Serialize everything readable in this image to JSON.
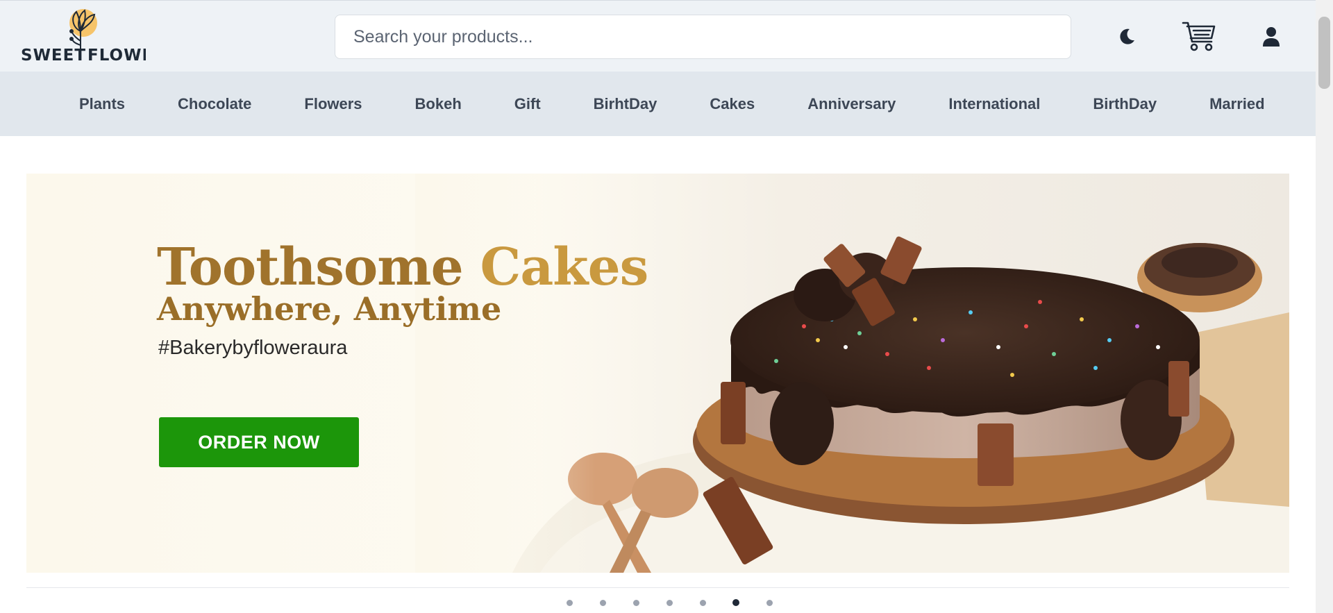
{
  "header": {
    "logo": {
      "line1": "SWEET",
      "line2": "FLOWER"
    },
    "search": {
      "placeholder": "Search your products..."
    },
    "icons": [
      "moon-icon",
      "cart-icon",
      "user-icon"
    ]
  },
  "categories": [
    "Plants",
    "Chocolate",
    "Flowers",
    "Bokeh",
    "Gift",
    "BirhtDay",
    "Cakes",
    "Anniversary",
    "International",
    "BirthDay",
    "Married"
  ],
  "banner": {
    "title_part1": "Toothsome",
    "title_part2": "Cakes",
    "subtitle": "Anywhere, Anytime",
    "tagline": "#Bakerybyfloweraura",
    "button_label": "ORDER NOW"
  },
  "carousel": {
    "total_slides": 7,
    "active_index": 5
  },
  "colors": {
    "header_bg": "#eef2f6",
    "nav_bg": "#e1e7ed",
    "button_green": "#1c960a",
    "title_gold": "#a0732c",
    "logo_sun": "#f6c46a"
  }
}
